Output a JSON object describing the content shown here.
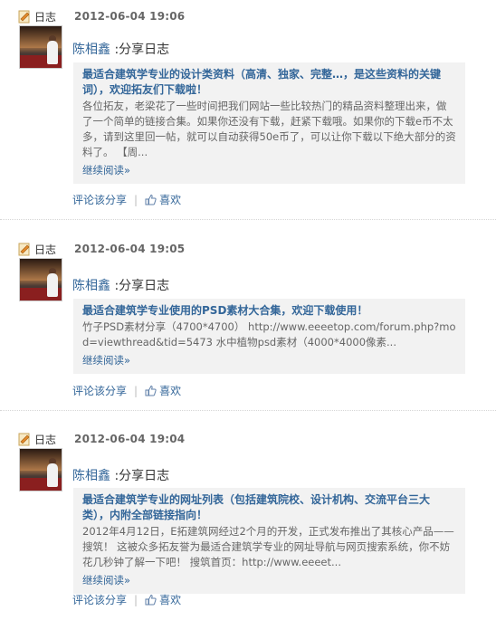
{
  "entries": [
    {
      "category": "日志",
      "timestamp": "2012-06-04 19:06",
      "author": "陈相鑫",
      "action": ":分享日志",
      "title": "最适合建筑学专业的设计类资料（高清、独家、完整…，是这些资料的关键词），欢迎拓友们下载啦！",
      "summary": "各位拓友，老梁花了一些时间把我们网站一些比较热门的精品资料整理出来，做了一个简单的链接合集。如果你还没有下载，赶紧下载哦。如果你的下载e币不太多，请到这里回一帖，就可以自动获得50e币了，可以让你下载以下绝大部分的资料了。 【周...",
      "more": "继续阅读»",
      "comment": "评论该分享",
      "like": "喜欢"
    },
    {
      "category": "日志",
      "timestamp": "2012-06-04 19:05",
      "author": "陈相鑫",
      "action": ":分享日志",
      "title": "最适合建筑学专业使用的PSD素材大合集，欢迎下载使用！",
      "summary": "竹子PSD素材分享（4700*4700） http://www.eeeetop.com/forum.php?mod=viewthread&tid=5473 水中植物psd素材（4000*4000像素...",
      "more": "继续阅读»",
      "comment": "评论该分享",
      "like": "喜欢"
    },
    {
      "category": "日志",
      "timestamp": "2012-06-04 19:04",
      "author": "陈相鑫",
      "action": ":分享日志",
      "title": "最适合建筑学专业的网址列表（包括建筑院校、设计机构、交流平台三大类），内附全部链接指向！",
      "summary": "2012年4月12日，E拓建筑网经过2个月的开发，正式发布推出了其核心产品——搜筑！ 这被众多拓友誉为最适合建筑学专业的网址导航与网页搜索系统，你不妨花几秒钟了解一下吧！ 搜筑首页：http://www.eeeet...",
      "more": "继续阅读»",
      "comment": "评论该分享",
      "like": "喜欢"
    }
  ]
}
